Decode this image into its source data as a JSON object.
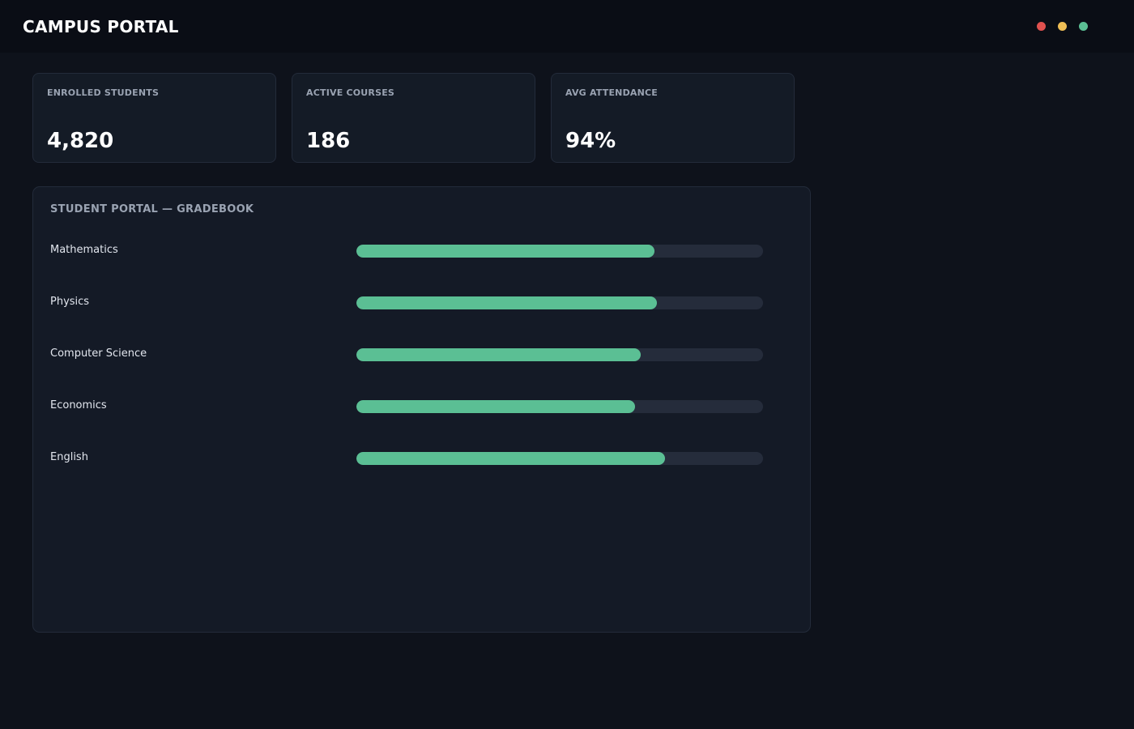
{
  "header": {
    "title": "CAMPUS PORTAL"
  },
  "window_controls": [
    {
      "name": "close",
      "color": "#e0514f"
    },
    {
      "name": "minimize",
      "color": "#efbe55"
    },
    {
      "name": "maximize",
      "color": "#5bbf94"
    }
  ],
  "stats": [
    {
      "label": "ENROLLED STUDENTS",
      "value": "4,820"
    },
    {
      "label": "ACTIVE COURSES",
      "value": "186"
    },
    {
      "label": "AVG ATTENDANCE",
      "value": "94%"
    }
  ],
  "gradebook": {
    "title": "STUDENT PORTAL — GRADEBOOK",
    "bar_color": "#5bbf94",
    "track_color": "#252c3b",
    "rows": [
      {
        "course": "Mathematics",
        "progress": 0.733
      },
      {
        "course": "Physics",
        "progress": 0.739
      },
      {
        "course": "Computer Science",
        "progress": 0.699
      },
      {
        "course": "Economics",
        "progress": 0.685
      },
      {
        "course": "English",
        "progress": 0.759
      }
    ]
  }
}
